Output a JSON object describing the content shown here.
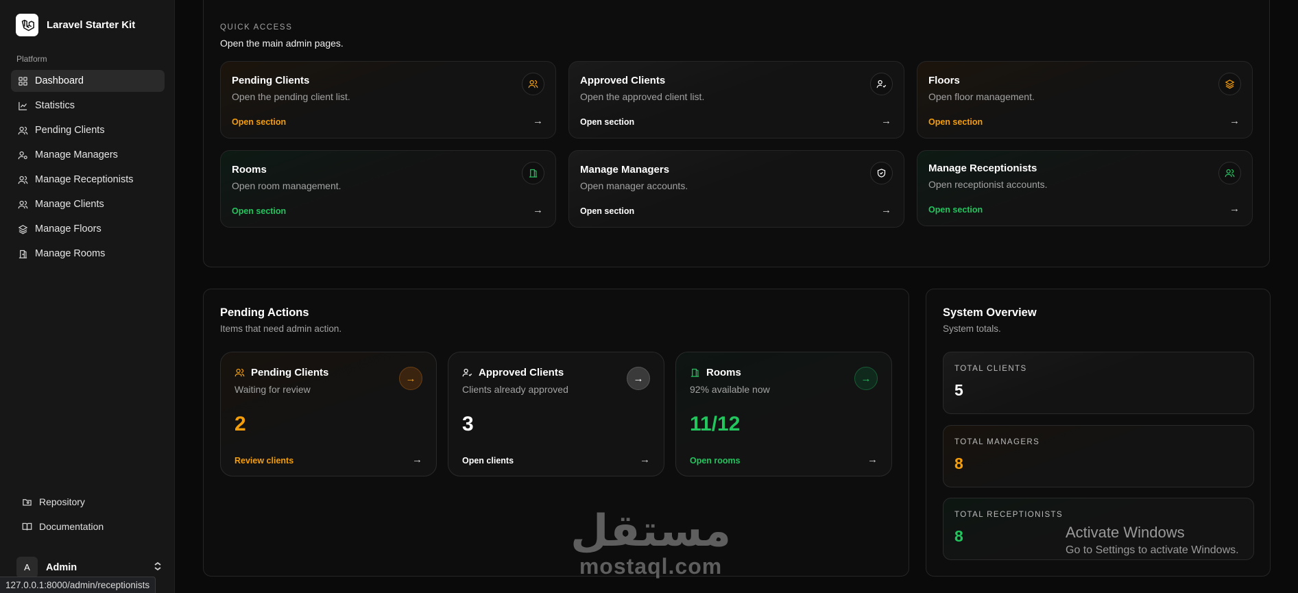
{
  "brand": {
    "name": "Laravel Starter Kit"
  },
  "sidebar": {
    "section_label": "Platform",
    "items": [
      {
        "label": "Dashboard",
        "icon": "layout-grid-icon",
        "active": true
      },
      {
        "label": "Statistics",
        "icon": "chart-icon",
        "active": false
      },
      {
        "label": "Pending Clients",
        "icon": "users-icon",
        "active": false
      },
      {
        "label": "Manage Managers",
        "icon": "user-cog-icon",
        "active": false
      },
      {
        "label": "Manage Receptionists",
        "icon": "users-icon",
        "active": false
      },
      {
        "label": "Manage Clients",
        "icon": "users-icon",
        "active": false
      },
      {
        "label": "Manage Floors",
        "icon": "layers-icon",
        "active": false
      },
      {
        "label": "Manage Rooms",
        "icon": "door-icon",
        "active": false
      }
    ],
    "footer": [
      {
        "label": "Repository",
        "icon": "folder-git-icon"
      },
      {
        "label": "Documentation",
        "icon": "book-icon"
      }
    ],
    "user": {
      "initial": "A",
      "name": "Admin"
    }
  },
  "status_url": "127.0.0.1:8000/admin/receptionists",
  "quick_access": {
    "eyebrow": "QUICK ACCESS",
    "subtitle": "Open the main admin pages.",
    "cards": [
      {
        "title": "Pending Clients",
        "desc": "Open the pending client list.",
        "link": "Open section",
        "icon": "users-icon",
        "accent": "#f59e0b"
      },
      {
        "title": "Approved Clients",
        "desc": "Open the approved client list.",
        "link": "Open section",
        "icon": "user-check-icon",
        "accent": "#ffffff"
      },
      {
        "title": "Floors",
        "desc": "Open floor management.",
        "link": "Open section",
        "icon": "layers-icon",
        "accent": "#f59e0b"
      },
      {
        "title": "Rooms",
        "desc": "Open room management.",
        "link": "Open section",
        "icon": "door-icon",
        "accent": "#22c55e"
      },
      {
        "title": "Manage Managers",
        "desc": "Open manager accounts.",
        "link": "Open section",
        "icon": "shield-icon",
        "accent": "#ffffff"
      },
      {
        "title": "Manage Receptionists",
        "desc": "Open receptionist accounts.",
        "link": "Open section",
        "icon": "users-icon",
        "accent": "#22c55e"
      }
    ]
  },
  "pending_actions": {
    "title": "Pending Actions",
    "subtitle": "Items that need admin action.",
    "cards": [
      {
        "title": "Pending Clients",
        "desc": "Waiting for review",
        "value": "2",
        "link": "Review clients",
        "icon": "users-icon",
        "accent": "#f59e0b"
      },
      {
        "title": "Approved Clients",
        "desc": "Clients already approved",
        "value": "3",
        "link": "Open clients",
        "icon": "user-check-icon",
        "accent": "#ffffff"
      },
      {
        "title": "Rooms",
        "desc": "92% available now",
        "value": "11/12",
        "link": "Open rooms",
        "icon": "door-icon",
        "accent": "#22c55e"
      }
    ]
  },
  "system_overview": {
    "title": "System Overview",
    "subtitle": "System totals.",
    "stats": [
      {
        "label": "TOTAL CLIENTS",
        "value": "5",
        "accent": "#ffffff"
      },
      {
        "label": "TOTAL MANAGERS",
        "value": "8",
        "accent": "#f59e0b"
      },
      {
        "label": "TOTAL RECEPTIONISTS",
        "value": "8",
        "accent": "#22c55e"
      }
    ]
  },
  "watermark": {
    "arabic": "مستقل",
    "latin": "mostaql.com"
  },
  "activation": {
    "title": "Activate Windows",
    "subtitle": "Go to Settings to activate Windows."
  }
}
